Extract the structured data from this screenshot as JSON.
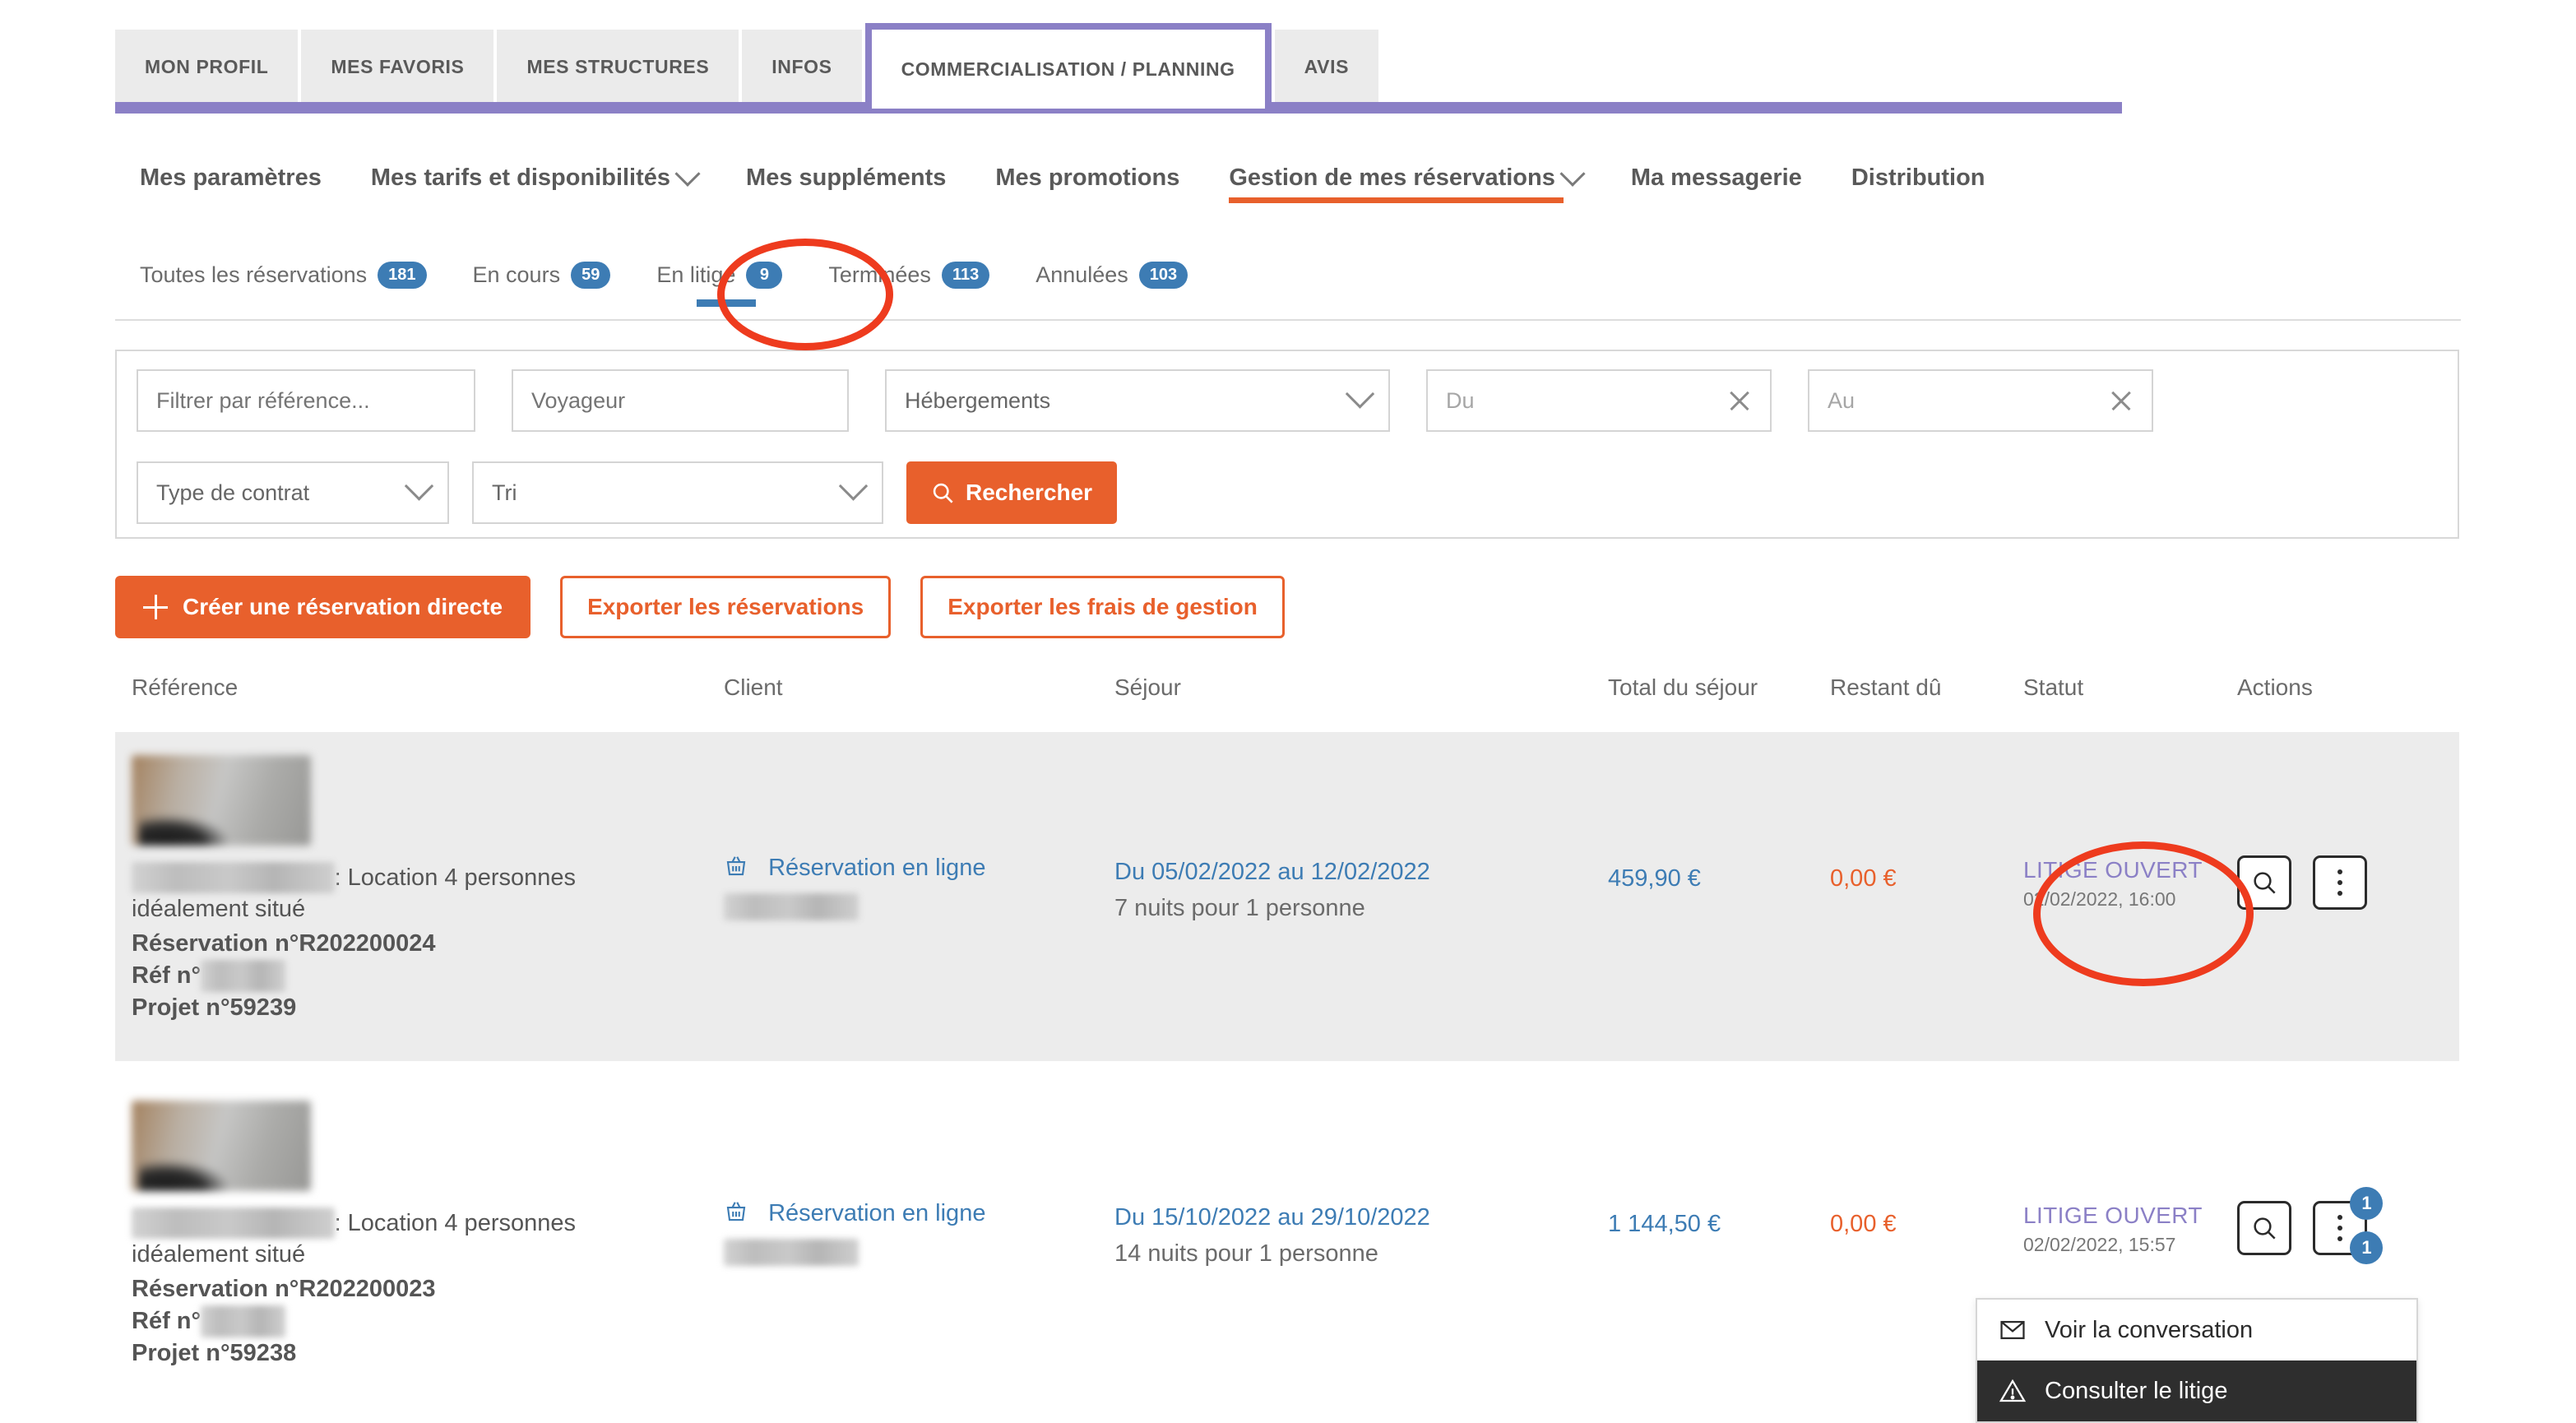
{
  "top_tabs": [
    {
      "label": "MON PROFIL",
      "active": false
    },
    {
      "label": "MES FAVORIS",
      "active": false
    },
    {
      "label": "MES STRUCTURES",
      "active": false
    },
    {
      "label": "INFOS",
      "active": false
    },
    {
      "label": "COMMERCIALISATION / PLANNING",
      "active": true
    },
    {
      "label": "AVIS",
      "active": false
    }
  ],
  "main_menu": [
    {
      "label": "Mes paramètres",
      "caret": false,
      "active": false
    },
    {
      "label": "Mes tarifs et disponibilités",
      "caret": true,
      "active": false
    },
    {
      "label": "Mes suppléments",
      "caret": false,
      "active": false
    },
    {
      "label": "Mes promotions",
      "caret": false,
      "active": false
    },
    {
      "label": "Gestion de mes réservations",
      "caret": true,
      "active": true
    },
    {
      "label": "Ma messagerie",
      "caret": false,
      "active": false
    },
    {
      "label": "Distribution",
      "caret": false,
      "active": false
    }
  ],
  "sub_tabs": [
    {
      "label": "Toutes les réservations",
      "count": "181",
      "active": false
    },
    {
      "label": "En cours",
      "count": "59",
      "active": false
    },
    {
      "label": "En litige",
      "count": "9",
      "active": true
    },
    {
      "label": "Terminées",
      "count": "113",
      "active": false
    },
    {
      "label": "Annulées",
      "count": "103",
      "active": false
    }
  ],
  "filters": {
    "reference_placeholder": "Filtrer par référence...",
    "reference_value": "",
    "voyageur_placeholder": "Voyageur",
    "voyageur_value": "",
    "hebergements_label": "Hébergements",
    "du_placeholder": "Du",
    "du_value": "",
    "au_placeholder": "Au",
    "au_value": "",
    "type_contrat_label": "Type de contrat",
    "tri_label": "Tri",
    "search_button": "Rechercher"
  },
  "actions": {
    "create_direct": "Créer une réservation directe",
    "export_reservations": "Exporter les réservations",
    "export_fees": "Exporter les frais de gestion"
  },
  "table": {
    "headers": {
      "reference": "Référence",
      "client": "Client",
      "sejour": "Séjour",
      "total": "Total du séjour",
      "restant": "Restant dû",
      "statut": "Statut",
      "actions": "Actions"
    },
    "rows": [
      {
        "title_redacted": "████████████",
        "title_suffix": ": Location 4 personnes idéalement situé",
        "reservation_no": "Réservation n°R202200024",
        "ref_no_label": "Réf n°",
        "ref_no_redacted": "█████",
        "projet_no": "Projet n°59239",
        "client_type": "Réservation en ligne",
        "client_sub_redacted": "████████",
        "sejour_dates": "Du 05/02/2022 au 12/02/2022",
        "sejour_detail": "7 nuits pour 1 personne",
        "total": "459,90 €",
        "restant": "0,00 €",
        "status": "LITIGE OUVERT",
        "status_date": "02/02/2022, 16:00",
        "badge_search": "",
        "badge_more": ""
      },
      {
        "title_redacted": "████████████",
        "title_suffix": ": Location 4 personnes idéalement situé",
        "reservation_no": "Réservation n°R202200023",
        "ref_no_label": "Réf n°",
        "ref_no_redacted": "█████",
        "projet_no": "Projet n°59238",
        "client_type": "Réservation en ligne",
        "client_sub_redacted": "████████",
        "sejour_dates": "Du 15/10/2022 au 29/10/2022",
        "sejour_detail": "14 nuits pour 1 personne",
        "total": "1 144,50 €",
        "restant": "0,00 €",
        "status": "LITIGE OUVERT",
        "status_date": "02/02/2022, 15:57",
        "badge_search": "1",
        "badge_more": "1"
      }
    ]
  },
  "dropdown": {
    "items": [
      {
        "label": "Voir la conversation",
        "icon": "envelope-icon",
        "highlighted": false
      },
      {
        "label": "Consulter le litige",
        "icon": "warning-triangle-icon",
        "highlighted": true
      }
    ]
  },
  "colors": {
    "purple": "#8b80c6",
    "orange": "#e8602c",
    "blue": "#3d7cb4",
    "annotation_red": "#ee3b1e",
    "status_purple": "#8b80c6"
  }
}
